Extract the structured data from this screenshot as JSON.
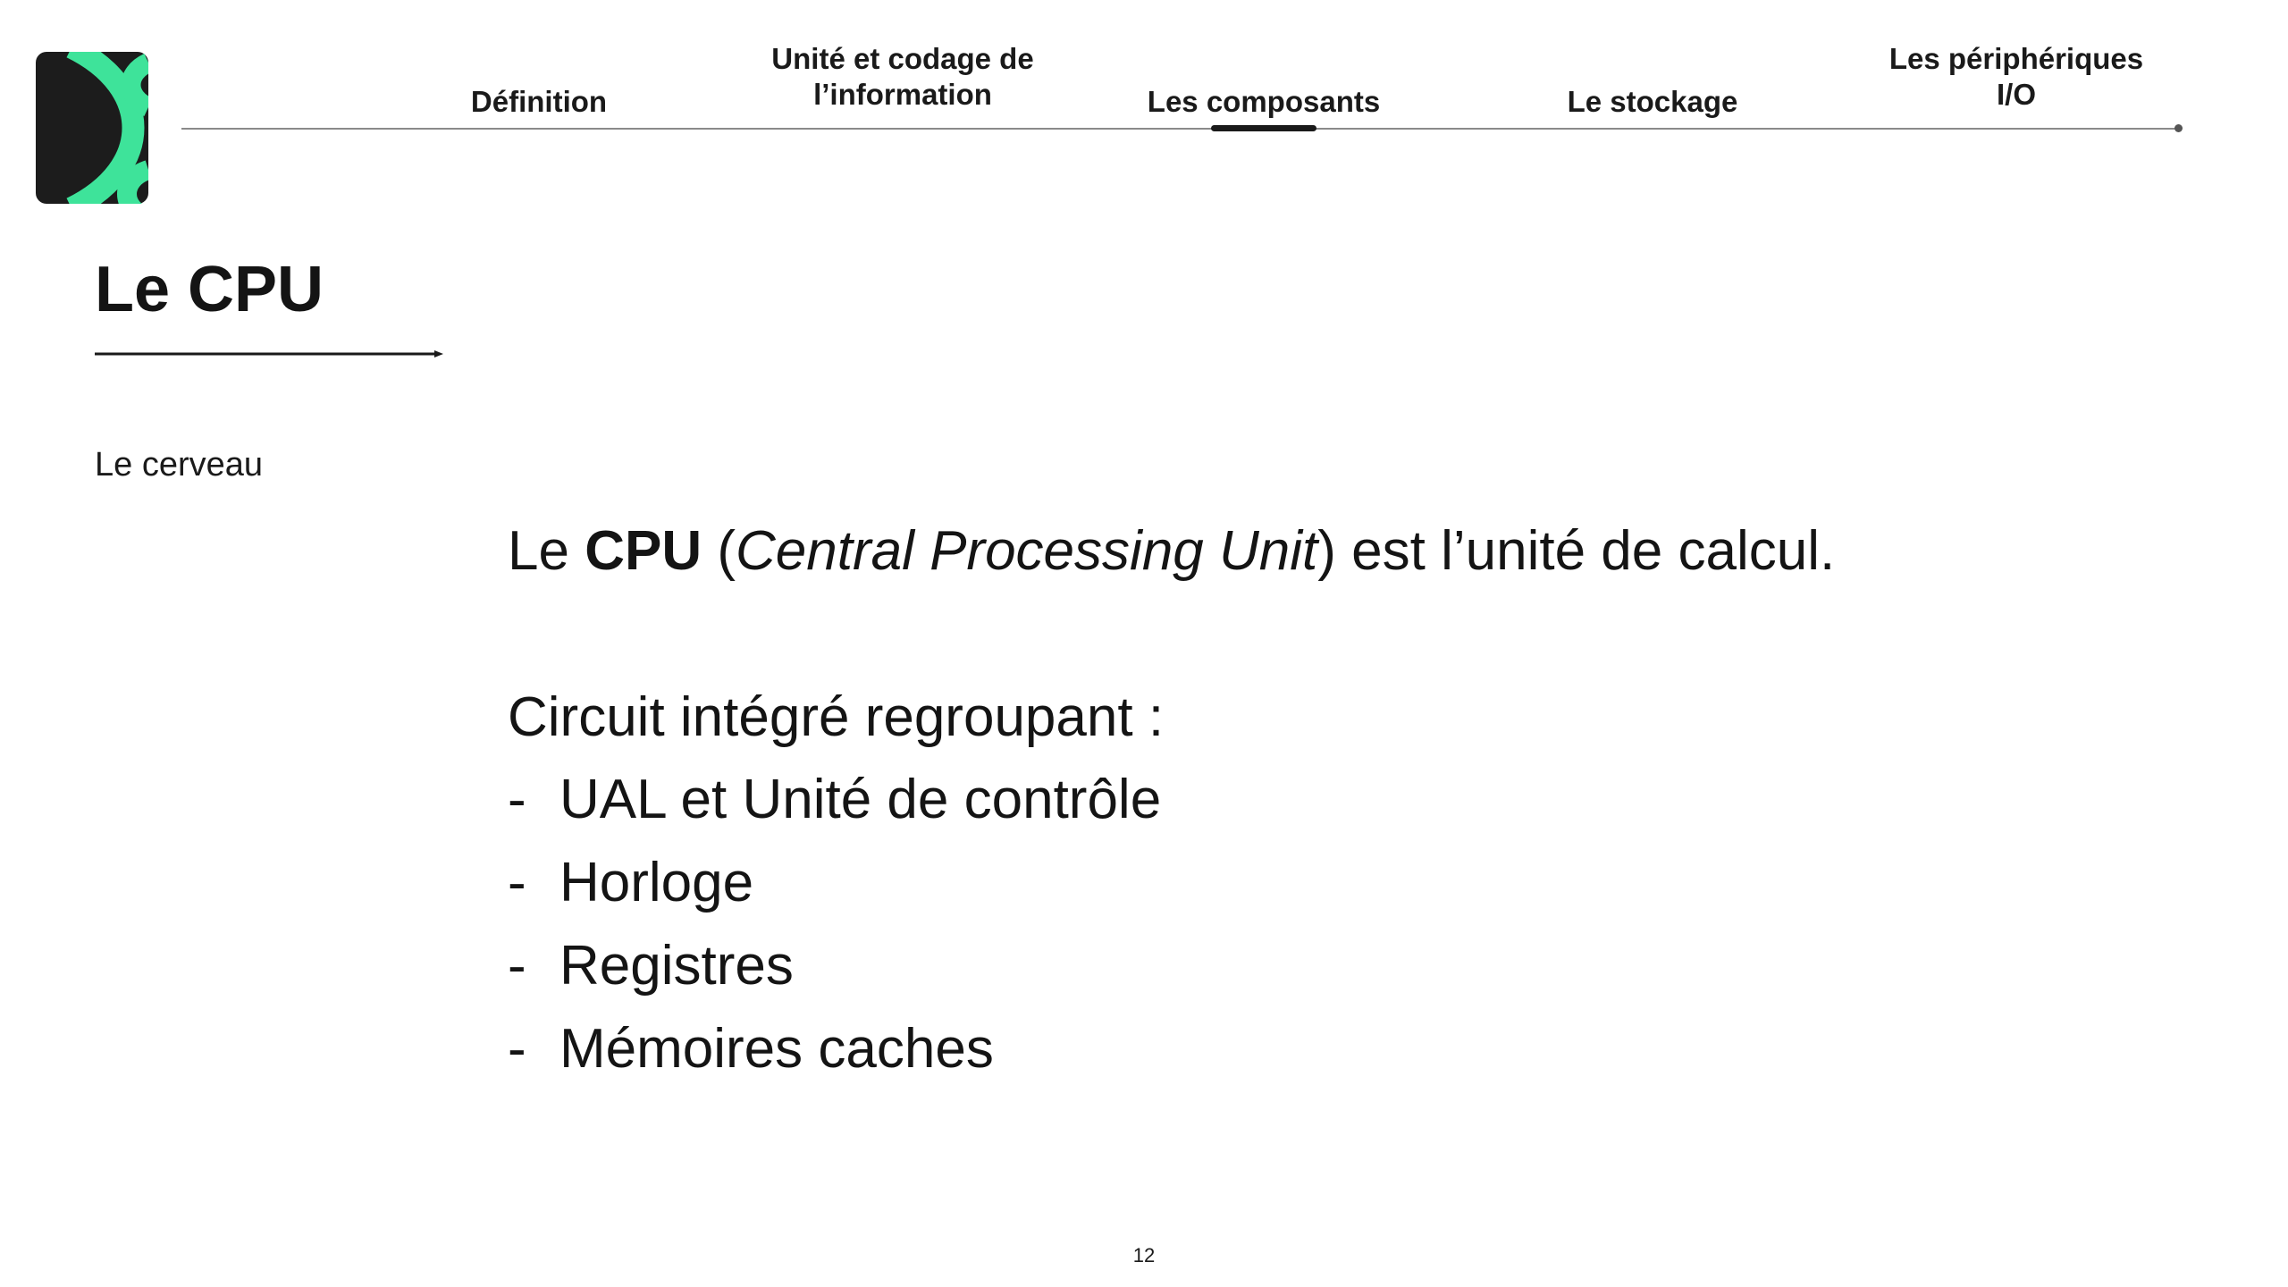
{
  "brand": {
    "accent_color": "#3ee39a",
    "dark_color": "#1c1c1c"
  },
  "nav": {
    "tabs": [
      {
        "label": "Définition",
        "active": false
      },
      {
        "label": "Unité et codage de\nl’information",
        "active": false
      },
      {
        "label": "Les composants",
        "active": true
      },
      {
        "label": "Le stockage",
        "active": false
      },
      {
        "label": "Les périphériques\nI/O",
        "active": false
      }
    ]
  },
  "slide": {
    "title": "Le CPU",
    "subtitle": "Le cerveau",
    "intro": {
      "prefix": "Le ",
      "bold": "CPU",
      "paren_open": " (",
      "italic": "Central Processing Unit",
      "suffix": ") est l’unité de calcul."
    },
    "list_lead": "Circuit intégré regroupant :",
    "bullet_marker": "-",
    "items": [
      "UAL et Unité de contrôle",
      "Horloge",
      "Registres",
      "Mémoires caches"
    ],
    "page_number": "12"
  }
}
